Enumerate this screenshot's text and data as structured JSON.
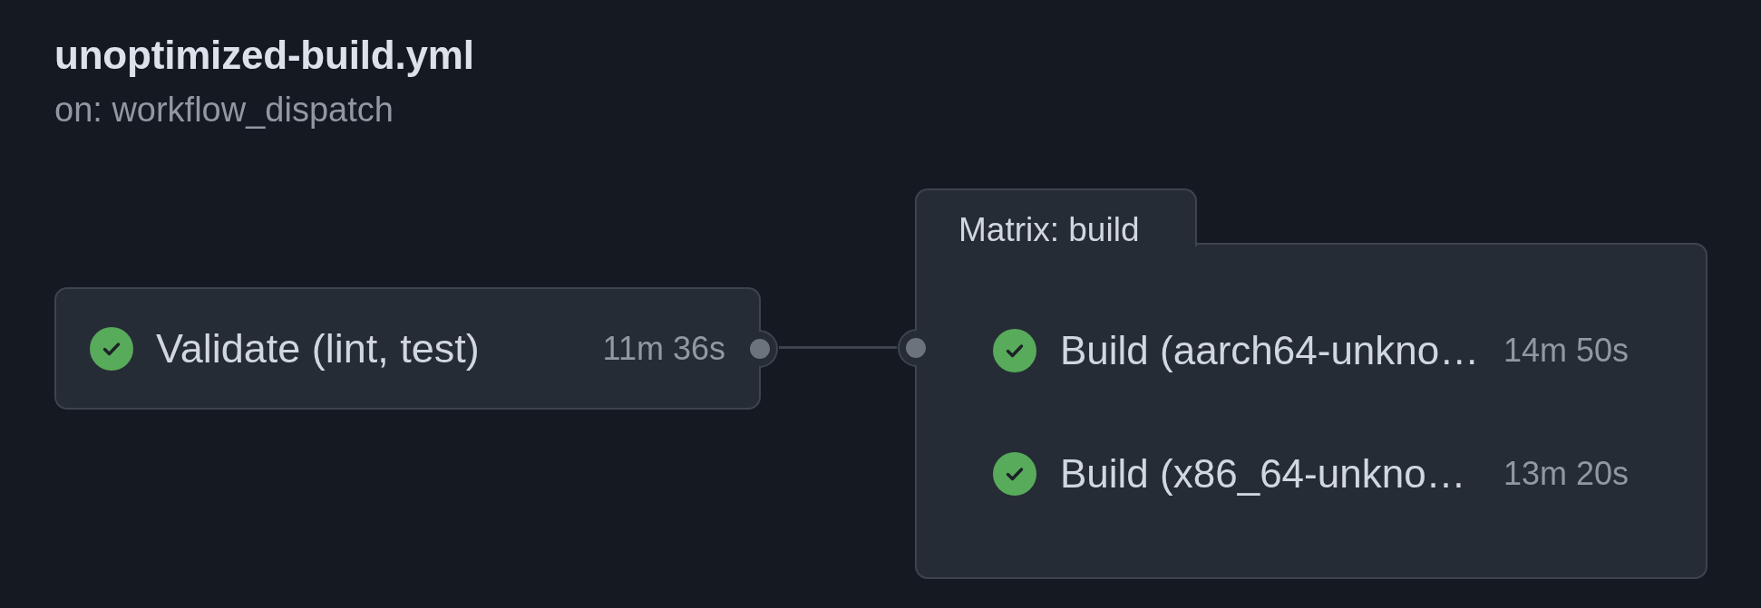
{
  "workflow": {
    "title": "unoptimized-build.yml",
    "trigger": "on: workflow_dispatch"
  },
  "jobs": [
    {
      "kind": "job",
      "name": "Validate (lint, test)",
      "duration": "11m 36s",
      "succeeded": true
    },
    {
      "kind": "matrix",
      "label": "Matrix: build",
      "jobs": [
        {
          "name": "Build (aarch64-unkno…",
          "duration": "14m 50s",
          "succeeded": true
        },
        {
          "name": "Build (x86_64-unkno…",
          "duration": "13m 20s",
          "succeeded": true
        }
      ]
    }
  ]
}
